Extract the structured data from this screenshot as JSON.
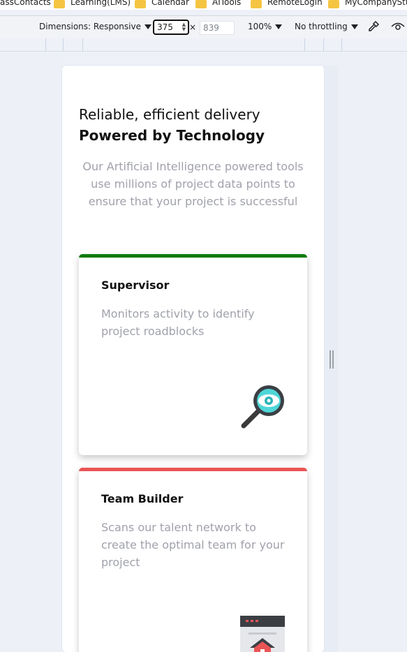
{
  "bookmarks": [
    {
      "label": "assContacts"
    },
    {
      "label": "Learning(LMS)"
    },
    {
      "label": "Calendar"
    },
    {
      "label": "AITools"
    },
    {
      "label": "RemoteLogin"
    },
    {
      "label": "MyCompanyStuff"
    }
  ],
  "devtools": {
    "dimensions_label": "Dimensions: Responsive",
    "width_value": "375",
    "times": "×",
    "height_placeholder": "839",
    "zoom_label": "100%",
    "throttling_label": "No throttling"
  },
  "page": {
    "hero_line1": "Reliable, efficient delivery",
    "hero_line2": "Powered by Technology",
    "intro": "Our Artificial Intelligence powered tools use millions of project data points to ensure that your project is successful",
    "cards": [
      {
        "title": "Supervisor",
        "description": "Monitors activity to identify project roadblocks",
        "accent": "#0d7a0d",
        "icon": "magnifier-eye-icon"
      },
      {
        "title": "Team Builder",
        "description": "Scans our talent network to create the optimal team for your project",
        "accent": "#ea5455",
        "icon": "team-builder-icon"
      }
    ]
  }
}
